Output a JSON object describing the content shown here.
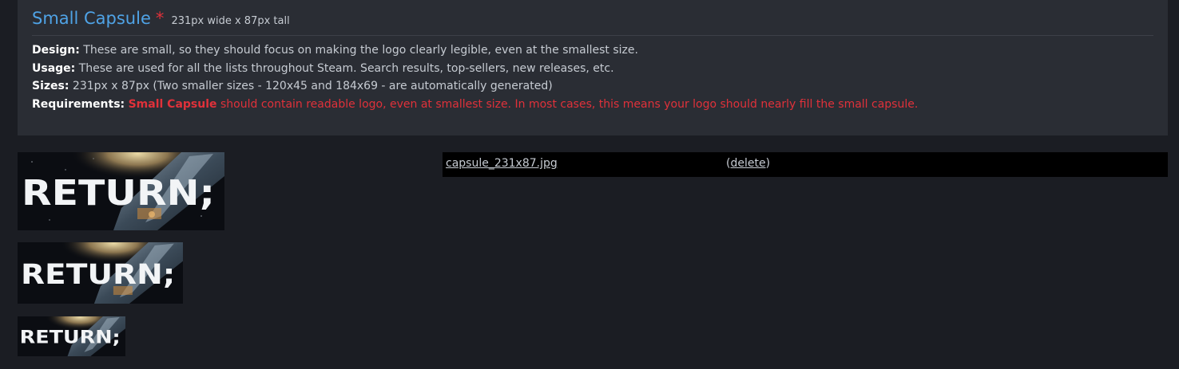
{
  "section": {
    "title": "Small Capsule",
    "required_marker": "*",
    "dimensions": "231px wide x 87px tall"
  },
  "details": {
    "design_label": "Design:",
    "design_text": " These are small, so they should focus on making the logo clearly legible, even at the smallest size.",
    "usage_label": "Usage:",
    "usage_text": " These are used for all the lists throughout Steam. Search results, top-sellers, new releases, etc.",
    "sizes_label": "Sizes:",
    "sizes_text": " 231px x 87px (Two smaller sizes - 120x45 and 184x69 - are automatically generated)",
    "requirements_label": "Requirements:",
    "requirements_emphasis": "Small Capsule",
    "requirements_text": " should contain readable logo, even at smallest size. In most cases, this means your logo should nearly fill the small capsule."
  },
  "previews": {
    "logo_text": "RETURN;"
  },
  "file": {
    "name": "capsule_231x87.jpg",
    "open_paren": "(",
    "delete_label": "delete",
    "close_paren": ")"
  },
  "colors": {
    "title": "#4fa3e6",
    "warning": "#e0313a",
    "panel": "#2a2d34",
    "background": "#1b1d23"
  }
}
